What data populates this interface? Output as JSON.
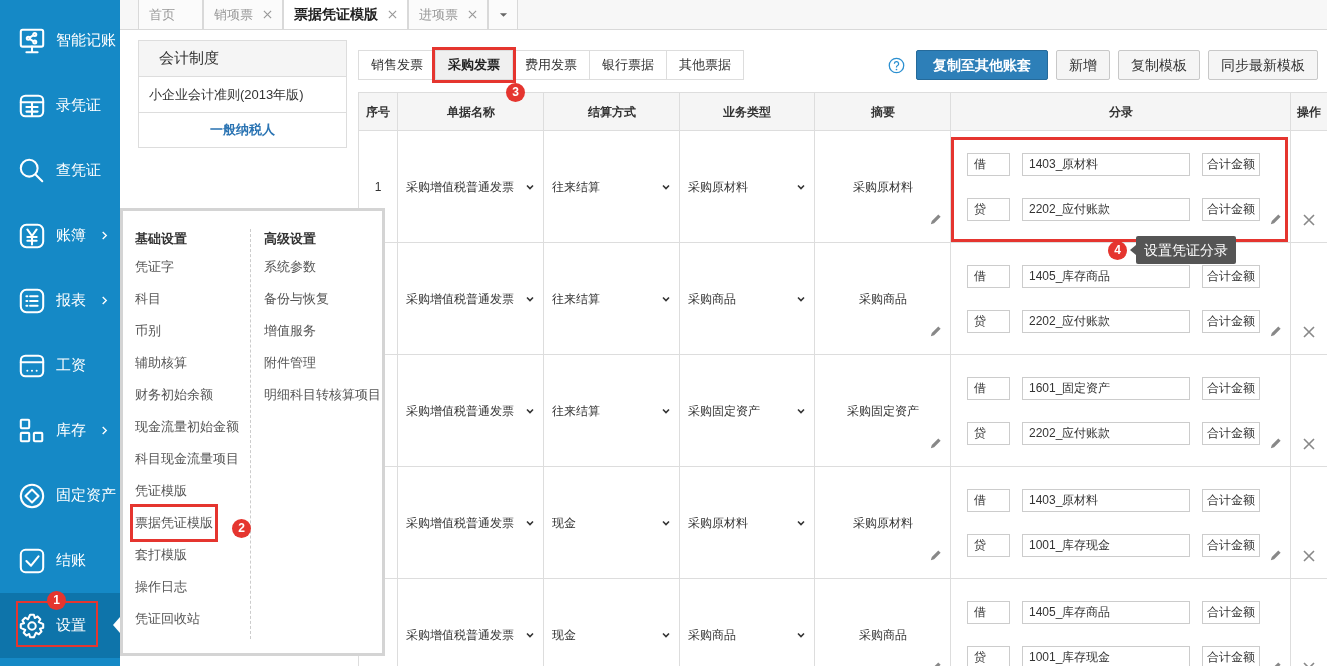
{
  "sidebar": {
    "items": [
      {
        "label": "智能记账",
        "has_submenu": false,
        "selected": false,
        "highlighted": false
      },
      {
        "label": "录凭证",
        "has_submenu": false,
        "selected": false,
        "highlighted": false
      },
      {
        "label": "查凭证",
        "has_submenu": false,
        "selected": false,
        "highlighted": false
      },
      {
        "label": "账簿",
        "has_submenu": true,
        "selected": false,
        "highlighted": false
      },
      {
        "label": "报表",
        "has_submenu": true,
        "selected": false,
        "highlighted": false
      },
      {
        "label": "工资",
        "has_submenu": false,
        "selected": false,
        "highlighted": false
      },
      {
        "label": "库存",
        "has_submenu": true,
        "selected": false,
        "highlighted": false
      },
      {
        "label": "固定资产",
        "has_submenu": false,
        "selected": false,
        "highlighted": false
      },
      {
        "label": "结账",
        "has_submenu": false,
        "selected": false,
        "highlighted": false
      },
      {
        "label": "设置",
        "has_submenu": false,
        "selected": true,
        "highlighted": true,
        "callout": "1"
      }
    ]
  },
  "page_tabs": [
    {
      "label": "首页",
      "closable": false,
      "selected": false
    },
    {
      "label": "销项票",
      "closable": true,
      "selected": false
    },
    {
      "label": "票据凭证模版",
      "closable": true,
      "selected": true
    },
    {
      "label": "进项票",
      "closable": true,
      "selected": false
    }
  ],
  "settings_menu": {
    "columns": [
      {
        "title": "基础设置",
        "items": [
          {
            "label": "凭证字",
            "highlighted": false
          },
          {
            "label": "科目",
            "highlighted": false
          },
          {
            "label": "币别",
            "highlighted": false
          },
          {
            "label": "辅助核算",
            "highlighted": false
          },
          {
            "label": "财务初始余额",
            "highlighted": false
          },
          {
            "label": "现金流量初始金额",
            "highlighted": false
          },
          {
            "label": "科目现金流量项目",
            "highlighted": false
          },
          {
            "label": "凭证模版",
            "highlighted": false
          },
          {
            "label": "票据凭证模版",
            "highlighted": true,
            "callout": "2"
          },
          {
            "label": "套打模版",
            "highlighted": false
          },
          {
            "label": "操作日志",
            "highlighted": false
          },
          {
            "label": "凭证回收站",
            "highlighted": false
          }
        ]
      },
      {
        "title": "高级设置",
        "items": [
          {
            "label": "系统参数",
            "highlighted": false
          },
          {
            "label": "备份与恢复",
            "highlighted": false
          },
          {
            "label": "增值服务",
            "highlighted": false
          },
          {
            "label": "附件管理",
            "highlighted": false
          },
          {
            "label": "明细科目转核算项目",
            "highlighted": false
          }
        ]
      }
    ]
  },
  "accounting_panel": {
    "header": "会计制度",
    "standard": "小企业会计准则(2013年版)",
    "taxpayer_type": "一般纳税人"
  },
  "invoice_tabs": [
    {
      "label": "销售发票",
      "selected": false,
      "highlighted": false
    },
    {
      "label": "采购发票",
      "selected": true,
      "highlighted": true,
      "callout": "3"
    },
    {
      "label": "费用发票",
      "selected": false,
      "highlighted": false
    },
    {
      "label": "银行票据",
      "selected": false,
      "highlighted": false
    },
    {
      "label": "其他票据",
      "selected": false,
      "highlighted": false
    }
  ],
  "buttons": [
    {
      "label": "复制至其他账套",
      "kind": "primary"
    },
    {
      "label": "新增",
      "kind": "default"
    },
    {
      "label": "复制模板",
      "kind": "default"
    },
    {
      "label": "同步最新模板",
      "kind": "default"
    }
  ],
  "table": {
    "columns": [
      "序号",
      "单据名称",
      "结算方式",
      "业务类型",
      "摘要",
      "分录",
      "操作"
    ],
    "rows": [
      {
        "seq": "1",
        "document": "采购增值税普通发票",
        "settlement": "往来结算",
        "business_type": "采购原材料",
        "summary": "采购原材料",
        "highlighted": true,
        "entries": [
          {
            "direction": "借",
            "account": "1403_原材料",
            "amount": "合计金额"
          },
          {
            "direction": "贷",
            "account": "2202_应付账款",
            "amount": "合计金额"
          }
        ]
      },
      {
        "document": "采购增值税普通发票",
        "settlement": "往来结算",
        "business_type": "采购商品",
        "summary": "采购商品",
        "highlighted": false,
        "entries": [
          {
            "direction": "借",
            "account": "1405_库存商品",
            "amount": "合计金额"
          },
          {
            "direction": "贷",
            "account": "2202_应付账款",
            "amount": "合计金额"
          }
        ]
      },
      {
        "document": "采购增值税普通发票",
        "settlement": "往来结算",
        "business_type": "采购固定资产",
        "summary": "采购固定资产",
        "highlighted": false,
        "entries": [
          {
            "direction": "借",
            "account": "1601_固定资产",
            "amount": "合计金额"
          },
          {
            "direction": "贷",
            "account": "2202_应付账款",
            "amount": "合计金额"
          }
        ]
      },
      {
        "document": "采购增值税普通发票",
        "settlement": "现金",
        "business_type": "采购原材料",
        "summary": "采购原材料",
        "highlighted": false,
        "entries": [
          {
            "direction": "借",
            "account": "1403_原材料",
            "amount": "合计金额"
          },
          {
            "direction": "贷",
            "account": "1001_库存现金",
            "amount": "合计金额"
          }
        ]
      },
      {
        "document": "采购增值税普通发票",
        "settlement": "现金",
        "business_type": "采购商品",
        "summary": "采购商品",
        "highlighted": false,
        "entries": [
          {
            "direction": "借",
            "account": "1405_库存商品",
            "amount": "合计金额"
          },
          {
            "direction": "贷",
            "account": "1001_库存现金",
            "amount": "合计金额"
          }
        ]
      }
    ]
  },
  "tooltip": {
    "text": "设置凭证分录",
    "callout": "4"
  }
}
